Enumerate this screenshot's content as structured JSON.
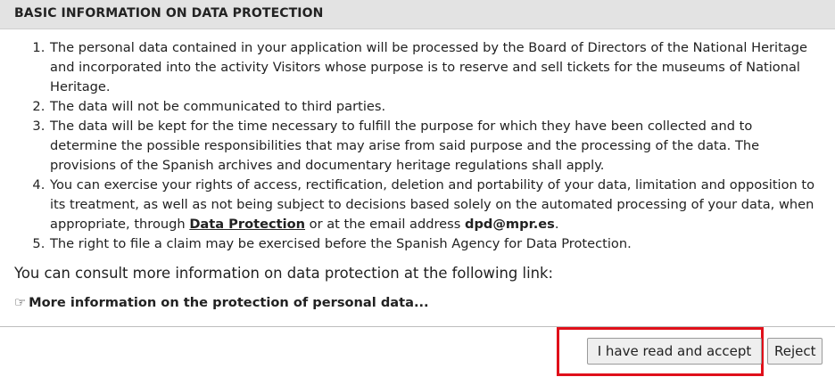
{
  "header": {
    "title": "BASIC INFORMATION ON DATA PROTECTION"
  },
  "items": [
    "The personal data contained in your application will be processed by the Board of Directors of the National Heritage and incorporated into the activity Visitors whose purpose is to reserve and sell tickets for the museums of National Heritage.",
    "The data will not be communicated to third parties.",
    "The data will be kept for the time necessary to fulfill the purpose for which they have been collected and to determine the possible responsibilities that may arise from said purpose and the processing of the data. The provisions of the Spanish archives and documentary heritage regulations shall apply.",
    {
      "before_link": "You can exercise your rights of access, rectification, deletion and portability of your data, limitation and opposition to its treatment, as well as not being subject to decisions based solely on the automated processing of your data, when appropriate, through ",
      "link_text": "Data Protection",
      "between": " or at the email address ",
      "email": "dpd@mpr.es",
      "after": "."
    },
    "The right to file a claim may be exercised before the Spanish Agency for Data Protection."
  ],
  "consult_text": "You can consult more information on data protection at the following link:",
  "more_info": {
    "icon": "pointing-hand-icon",
    "glyph": "☞",
    "label": "More information on the protection of personal data..."
  },
  "footer": {
    "accept_label": "I have read and accept",
    "reject_label": "Reject",
    "highlight_color": "#e0101a"
  }
}
